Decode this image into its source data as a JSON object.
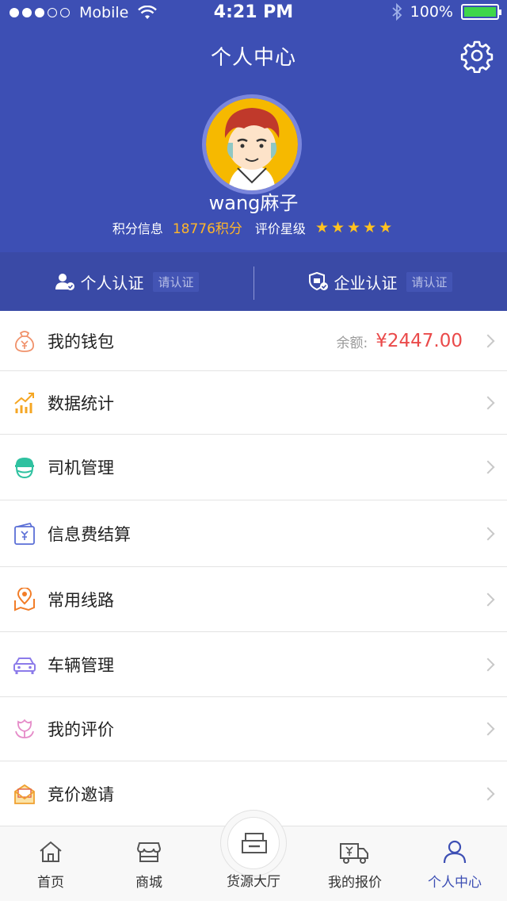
{
  "status_bar": {
    "carrier": "Mobile",
    "time": "4:21 PM",
    "battery": "100%"
  },
  "header": {
    "title": "个人中心",
    "username": "wang麻子",
    "points_label": "积分信息",
    "points_value": "18776积分",
    "rating_label": "评价星级",
    "rating_stars": 5
  },
  "verification": {
    "personal_label": "个人认证",
    "personal_status": "请认证",
    "enterprise_label": "企业认证",
    "enterprise_status": "请认证"
  },
  "menu": {
    "items": [
      {
        "label": "我的钱包",
        "icon": "wallet-icon",
        "color": "#f0916a"
      },
      {
        "label": "数据统计",
        "icon": "chart-icon",
        "color": "#f5a623"
      },
      {
        "label": "司机管理",
        "icon": "driver-icon",
        "color": "#2fc1a0"
      },
      {
        "label": "信息费结算",
        "icon": "settlement-icon",
        "color": "#5b6fd6"
      },
      {
        "label": "常用线路",
        "icon": "route-icon",
        "color": "#f27d28"
      },
      {
        "label": "车辆管理",
        "icon": "car-icon",
        "color": "#8c7bea"
      },
      {
        "label": "我的评价",
        "icon": "flower-icon",
        "color": "#e58bc8"
      },
      {
        "label": "竞价邀请",
        "icon": "envelope-icon",
        "color": "#f0a030"
      }
    ],
    "wallet_balance_label": "余额:",
    "wallet_balance_value": "¥2447.00"
  },
  "tabbar": {
    "items": [
      {
        "label": "首页",
        "icon": "home-icon"
      },
      {
        "label": "商城",
        "icon": "store-icon"
      },
      {
        "label": "货源大厅",
        "icon": "cargo-hall-icon"
      },
      {
        "label": "我的报价",
        "icon": "quote-truck-icon"
      },
      {
        "label": "个人中心",
        "icon": "person-icon"
      }
    ],
    "active_index": 4,
    "active_color": "#3d4fb4"
  },
  "colors": {
    "header_bg": "#3d4fb4",
    "accent_points": "#ffb62a",
    "star": "#ffc21f",
    "balance": "#ea4a4a"
  }
}
